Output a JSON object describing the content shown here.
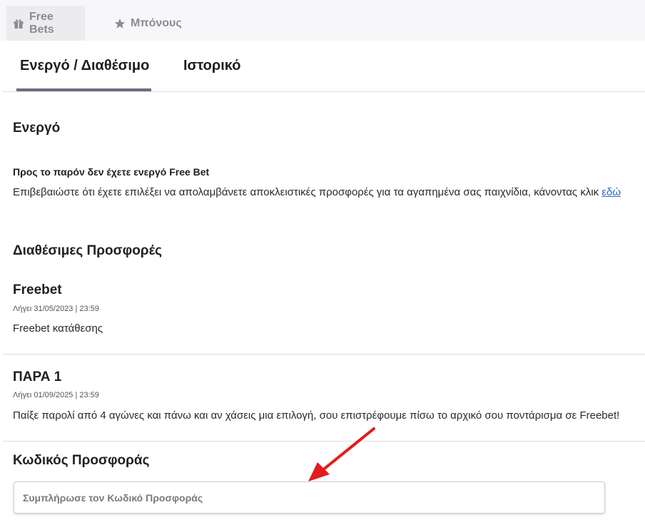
{
  "top_tabs": [
    {
      "label": "Free Bets",
      "icon": "gift-icon",
      "active": true
    },
    {
      "label": "Μπόνους",
      "icon": "star-icon",
      "active": false
    }
  ],
  "sub_tabs": [
    {
      "label": "Ενεργό / Διαθέσιμο",
      "active": true
    },
    {
      "label": "Ιστορικό",
      "active": false
    }
  ],
  "active_section": {
    "heading": "Ενεργό",
    "notice_title": "Προς το παρόν δεν έχετε ενεργό Free Bet",
    "notice_text": "Επιβεβαιώστε ότι έχετε επιλέξει να απολαμβάνετε αποκλειστικές προσφορές για τα αγαπημένα σας παιχνίδια, κάνοντας κλικ",
    "notice_link": "εδώ"
  },
  "offers_section": {
    "heading": "Διαθέσιμες Προσφορές",
    "offers": [
      {
        "title": "Freebet",
        "expiry": "Λήγει 31/05/2023 | 23:59",
        "description": "Freebet κατάθεσης"
      },
      {
        "title": "ΠΑΡΑ 1",
        "expiry": "Λήγει 01/09/2025 | 23:59",
        "description": "Παίξε παρολί από 4 αγώνες και πάνω και αν χάσεις μια επιλογή, σου επιστρέφουμε πίσω το αρχικό σου ποντάρισμα σε Freebet!"
      }
    ]
  },
  "promo_code": {
    "heading": "Κωδικός Προσφοράς",
    "placeholder": "Συμπλήρωσε τον Κωδικό Προσφοράς",
    "value": ""
  },
  "colors": {
    "tab_indicator": "#6c6f80",
    "link": "#2a6bbd",
    "annotation_arrow": "#e31b1b"
  }
}
